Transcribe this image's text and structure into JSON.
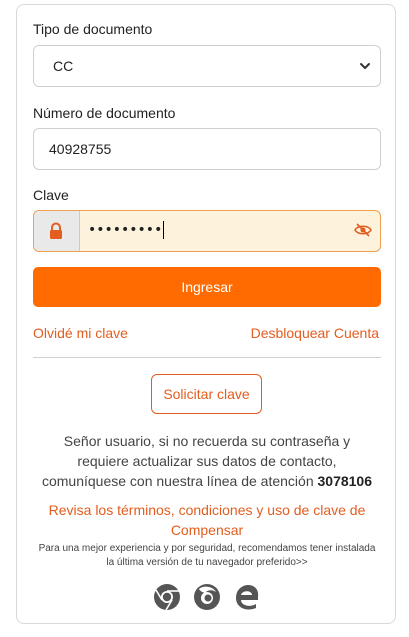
{
  "form": {
    "doc_type_label": "Tipo de documento",
    "doc_type_value": "CC",
    "doc_number_label": "Número de documento",
    "doc_number_value": "40928755",
    "password_label": "Clave",
    "password_masked": "•••••••••",
    "submit_label": "Ingresar"
  },
  "links": {
    "forgot": "Olvidé mi clave",
    "unlock": "Desbloquear Cuenta"
  },
  "request_button": "Solicitar clave",
  "info": {
    "text": "Señor usuario, si no recuerda su contraseña y requiere actualizar sus datos de contacto, comuníquese con nuestra línea de atención",
    "phone": "3078106"
  },
  "terms_link": "Revisa los términos, condiciones y uso de clave de Compensar",
  "browser_note": "Para una mejor experiencia y por seguridad, recomendamos tener instalada la última versión de tu navegador preferido>>",
  "browsers": [
    "chrome-icon",
    "firefox-icon",
    "edge-icon"
  ],
  "colors": {
    "accent": "#ff6b00",
    "link": "#e25d1e",
    "password_bg": "#fdf3dc"
  }
}
